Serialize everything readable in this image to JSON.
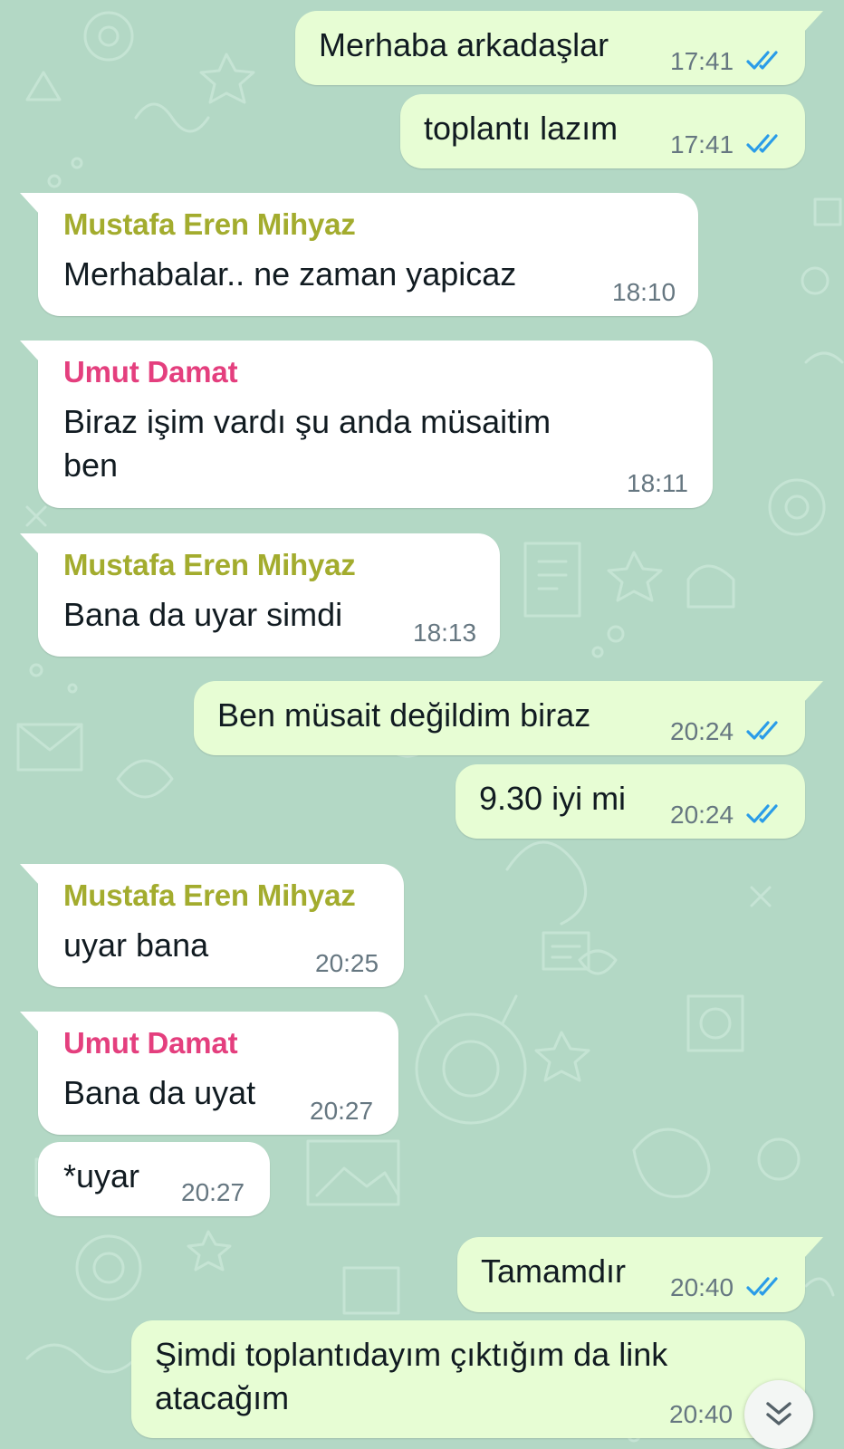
{
  "colors": {
    "wallpaper": "#b3d8c5",
    "outgoing_bubble": "#e7fdd4",
    "incoming_bubble": "#ffffff",
    "read_ticks": "#2a9ce8",
    "timestamp": "#667781",
    "sender_mustafa": "#a3ac2e",
    "sender_umut": "#e43f7e"
  },
  "messages": [
    {
      "dir": "out",
      "text": "Merhaba arkadaşlar",
      "time": "17:41",
      "status": "read"
    },
    {
      "dir": "out",
      "text": "toplantı lazım",
      "time": "17:41",
      "status": "read"
    },
    {
      "dir": "in",
      "sender": "Mustafa Eren Mihyaz",
      "text": "Merhabalar.. ne zaman yapicaz",
      "time": "18:10"
    },
    {
      "dir": "in",
      "sender": "Umut Damat",
      "text": "Biraz işim vardı şu anda müsaitim\nben",
      "time": "18:11"
    },
    {
      "dir": "in",
      "sender": "Mustafa Eren Mihyaz",
      "text": "Bana da uyar simdi",
      "time": "18:13"
    },
    {
      "dir": "out",
      "text": "Ben müsait değildim biraz",
      "time": "20:24",
      "status": "read"
    },
    {
      "dir": "out",
      "text": "9.30 iyi mi",
      "time": "20:24",
      "status": "read"
    },
    {
      "dir": "in",
      "sender": "Mustafa Eren Mihyaz",
      "text": "uyar bana",
      "time": "20:25"
    },
    {
      "dir": "in",
      "sender": "Umut Damat",
      "text": "Bana da uyat",
      "time": "20:27"
    },
    {
      "dir": "in",
      "text": "*uyar",
      "time": "20:27"
    },
    {
      "dir": "out",
      "text": "Tamamdır",
      "time": "20:40",
      "status": "read"
    },
    {
      "dir": "out",
      "text": "Şimdi toplantıdayım çıktığım da link\natacağım",
      "time": "20:40"
    }
  ],
  "scroll_button": {
    "icon": "chevron-double-down-icon"
  }
}
